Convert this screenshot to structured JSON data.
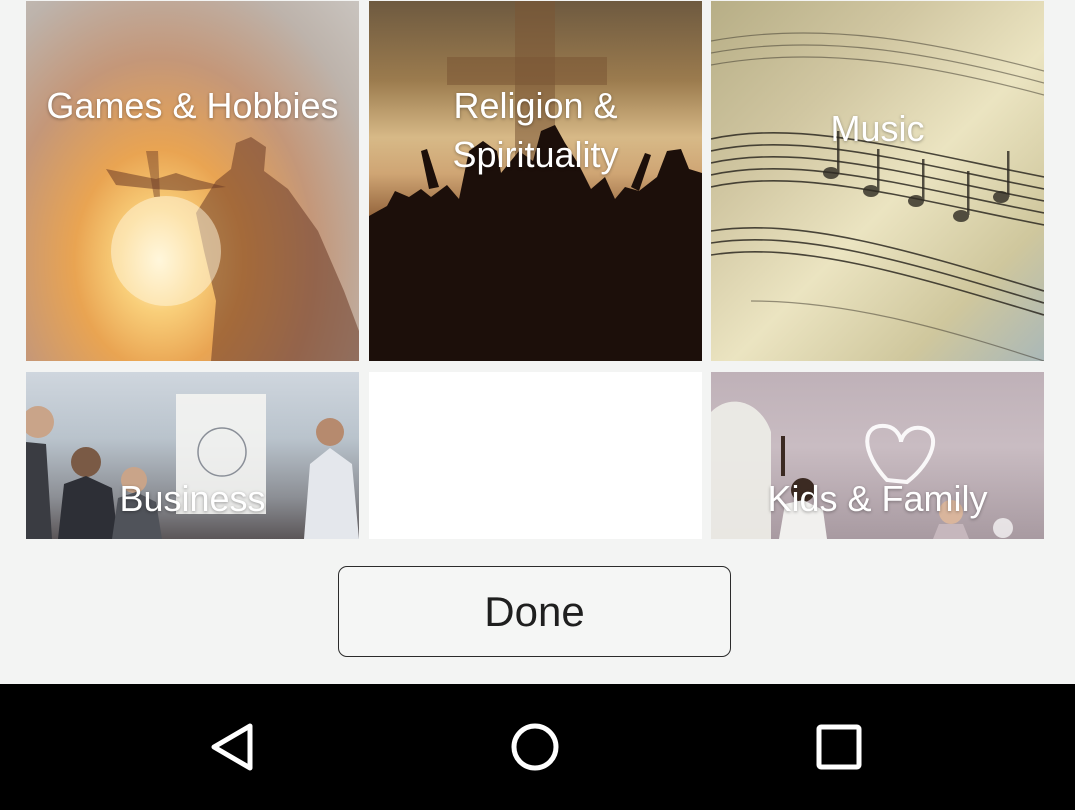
{
  "categories": [
    {
      "id": "games",
      "label": "Games & Hobbies"
    },
    {
      "id": "religion",
      "label": "Religion & Spirituality"
    },
    {
      "id": "music",
      "label": "Music"
    },
    {
      "id": "business",
      "label": "Business"
    },
    {
      "id": "empty",
      "label": ""
    },
    {
      "id": "kids",
      "label": "Kids & Family"
    }
  ],
  "done_label": "Done",
  "nav": {
    "back_icon": "back-triangle-icon",
    "home_icon": "home-circle-icon",
    "recents_icon": "recents-square-icon"
  },
  "colors": {
    "background": "#f3f4f3",
    "nav_bar": "#000000",
    "tile_text": "#ffffff"
  }
}
